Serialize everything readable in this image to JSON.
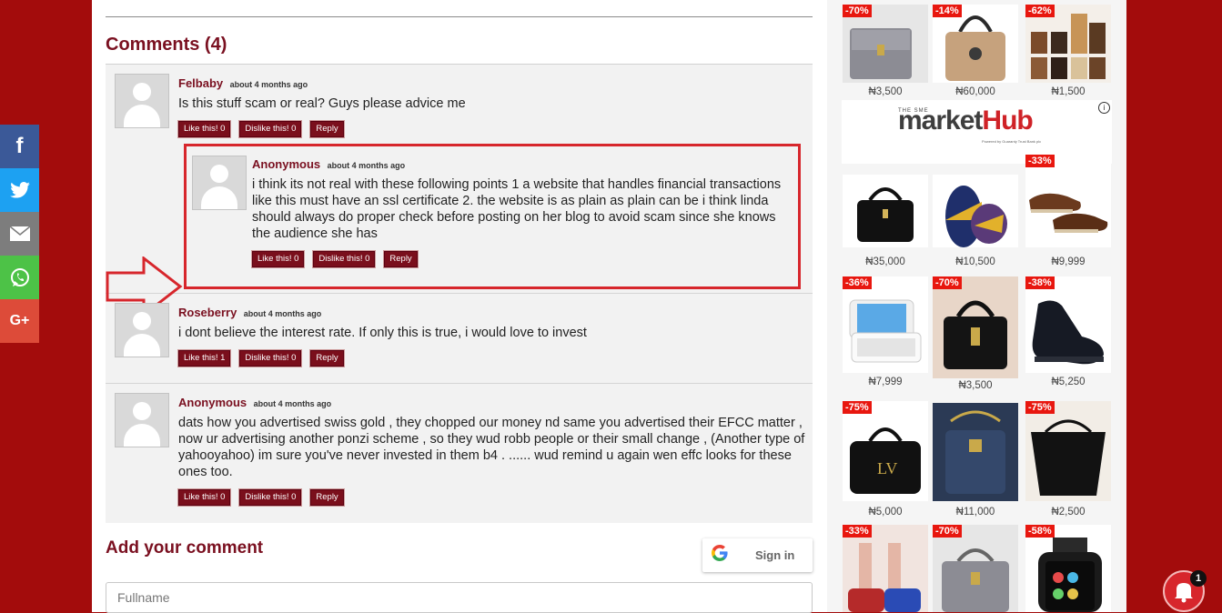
{
  "comments_section": {
    "title": "Comments (4)",
    "comments": [
      {
        "author": "Felbaby",
        "time": "about 4 months ago",
        "text": "Is this stuff scam or real? Guys please advice me",
        "like": "Like this! 0",
        "dislike": "Dislike this! 0",
        "reply": "Reply"
      },
      {
        "author": "Anonymous",
        "time": "about 4 months ago",
        "text": "i think its not real with these following points 1 a website that handles financial transactions like this must have an ssl certificate 2. the website is as plain as plain can be i think linda should always do proper check before posting on her blog to avoid scam since she knows the audience she has",
        "like": "Like this! 0",
        "dislike": "Dislike this! 0",
        "reply": "Reply"
      },
      {
        "author": "Roseberry",
        "time": "about 4 months ago",
        "text": "i dont believe the interest rate. If only this is true, i would love to invest",
        "like": "Like this! 1",
        "dislike": "Dislike this! 0",
        "reply": "Reply"
      },
      {
        "author": "Anonymous",
        "time": "about 4 months ago",
        "text": "dats how you advertised swiss gold , they chopped our money nd same you advertised their EFCC matter , now ur advertising another ponzi scheme , so they wud robb people or their small change , (Another type of yahooyahoo) im sure you've never invested in them b4 . ...... wud remind u again wen effc looks for these ones too.",
        "like": "Like this! 0",
        "dislike": "Dislike this! 0",
        "reply": "Reply"
      }
    ]
  },
  "add_comment": {
    "title": "Add your comment",
    "google_sign_in": "Sign in",
    "fullname_placeholder": "Fullname"
  },
  "share_bar": {
    "icons": [
      "facebook-icon",
      "twitter-icon",
      "email-icon",
      "whatsapp-icon",
      "google-plus-icon"
    ],
    "gplus_label": "G+"
  },
  "ads": {
    "banner": {
      "small_title": "THE SME",
      "brand_part1": "market",
      "brand_part2": "Hub",
      "powered": "Powered by Guaranty Trust Bank plc"
    },
    "top_row": [
      {
        "discount": "-70%",
        "price": "₦3,500"
      },
      {
        "discount": "-14%",
        "price": "₦60,000"
      },
      {
        "discount": "-62%",
        "price": "₦1,500"
      }
    ],
    "grid_rows": [
      [
        {
          "discount": "",
          "price": "₦35,000"
        },
        {
          "discount": "",
          "price": "₦10,500"
        },
        {
          "discount": "-33%",
          "price": "₦9,999"
        }
      ],
      [
        {
          "discount": "-36%",
          "price": "₦7,999"
        },
        {
          "discount": "-70%",
          "price": "₦3,500"
        },
        {
          "discount": "-38%",
          "price": "₦5,250"
        }
      ],
      [
        {
          "discount": "-75%",
          "price": "₦5,000"
        },
        {
          "discount": "",
          "price": "₦11,000"
        },
        {
          "discount": "-75%",
          "price": "₦2,500"
        }
      ],
      [
        {
          "discount": "-33%",
          "price": ""
        },
        {
          "discount": "-70%",
          "price": ""
        },
        {
          "discount": "-58%",
          "price": ""
        }
      ]
    ]
  },
  "notification": {
    "count": "1"
  },
  "colors": {
    "brand": "#7a1020",
    "background": "#a30c0c",
    "highlight_box": "#d7262c"
  }
}
